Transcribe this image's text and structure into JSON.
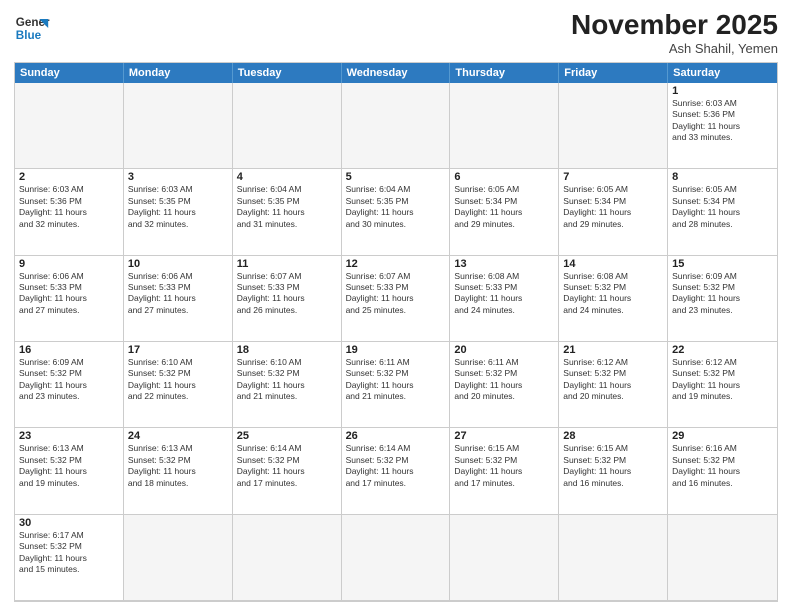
{
  "header": {
    "logo_general": "General",
    "logo_blue": "Blue",
    "month_year": "November 2025",
    "location": "Ash Shahil, Yemen"
  },
  "days_of_week": [
    "Sunday",
    "Monday",
    "Tuesday",
    "Wednesday",
    "Thursday",
    "Friday",
    "Saturday"
  ],
  "weeks": [
    [
      {
        "day": "",
        "info": ""
      },
      {
        "day": "",
        "info": ""
      },
      {
        "day": "",
        "info": ""
      },
      {
        "day": "",
        "info": ""
      },
      {
        "day": "",
        "info": ""
      },
      {
        "day": "",
        "info": ""
      },
      {
        "day": "1",
        "info": "Sunrise: 6:03 AM\nSunset: 5:36 PM\nDaylight: 11 hours\nand 33 minutes."
      }
    ],
    [
      {
        "day": "2",
        "info": "Sunrise: 6:03 AM\nSunset: 5:36 PM\nDaylight: 11 hours\nand 32 minutes."
      },
      {
        "day": "3",
        "info": "Sunrise: 6:03 AM\nSunset: 5:35 PM\nDaylight: 11 hours\nand 32 minutes."
      },
      {
        "day": "4",
        "info": "Sunrise: 6:04 AM\nSunset: 5:35 PM\nDaylight: 11 hours\nand 31 minutes."
      },
      {
        "day": "5",
        "info": "Sunrise: 6:04 AM\nSunset: 5:35 PM\nDaylight: 11 hours\nand 30 minutes."
      },
      {
        "day": "6",
        "info": "Sunrise: 6:05 AM\nSunset: 5:34 PM\nDaylight: 11 hours\nand 29 minutes."
      },
      {
        "day": "7",
        "info": "Sunrise: 6:05 AM\nSunset: 5:34 PM\nDaylight: 11 hours\nand 29 minutes."
      },
      {
        "day": "8",
        "info": "Sunrise: 6:05 AM\nSunset: 5:34 PM\nDaylight: 11 hours\nand 28 minutes."
      }
    ],
    [
      {
        "day": "9",
        "info": "Sunrise: 6:06 AM\nSunset: 5:33 PM\nDaylight: 11 hours\nand 27 minutes."
      },
      {
        "day": "10",
        "info": "Sunrise: 6:06 AM\nSunset: 5:33 PM\nDaylight: 11 hours\nand 27 minutes."
      },
      {
        "day": "11",
        "info": "Sunrise: 6:07 AM\nSunset: 5:33 PM\nDaylight: 11 hours\nand 26 minutes."
      },
      {
        "day": "12",
        "info": "Sunrise: 6:07 AM\nSunset: 5:33 PM\nDaylight: 11 hours\nand 25 minutes."
      },
      {
        "day": "13",
        "info": "Sunrise: 6:08 AM\nSunset: 5:33 PM\nDaylight: 11 hours\nand 24 minutes."
      },
      {
        "day": "14",
        "info": "Sunrise: 6:08 AM\nSunset: 5:32 PM\nDaylight: 11 hours\nand 24 minutes."
      },
      {
        "day": "15",
        "info": "Sunrise: 6:09 AM\nSunset: 5:32 PM\nDaylight: 11 hours\nand 23 minutes."
      }
    ],
    [
      {
        "day": "16",
        "info": "Sunrise: 6:09 AM\nSunset: 5:32 PM\nDaylight: 11 hours\nand 23 minutes."
      },
      {
        "day": "17",
        "info": "Sunrise: 6:10 AM\nSunset: 5:32 PM\nDaylight: 11 hours\nand 22 minutes."
      },
      {
        "day": "18",
        "info": "Sunrise: 6:10 AM\nSunset: 5:32 PM\nDaylight: 11 hours\nand 21 minutes."
      },
      {
        "day": "19",
        "info": "Sunrise: 6:11 AM\nSunset: 5:32 PM\nDaylight: 11 hours\nand 21 minutes."
      },
      {
        "day": "20",
        "info": "Sunrise: 6:11 AM\nSunset: 5:32 PM\nDaylight: 11 hours\nand 20 minutes."
      },
      {
        "day": "21",
        "info": "Sunrise: 6:12 AM\nSunset: 5:32 PM\nDaylight: 11 hours\nand 20 minutes."
      },
      {
        "day": "22",
        "info": "Sunrise: 6:12 AM\nSunset: 5:32 PM\nDaylight: 11 hours\nand 19 minutes."
      }
    ],
    [
      {
        "day": "23",
        "info": "Sunrise: 6:13 AM\nSunset: 5:32 PM\nDaylight: 11 hours\nand 19 minutes."
      },
      {
        "day": "24",
        "info": "Sunrise: 6:13 AM\nSunset: 5:32 PM\nDaylight: 11 hours\nand 18 minutes."
      },
      {
        "day": "25",
        "info": "Sunrise: 6:14 AM\nSunset: 5:32 PM\nDaylight: 11 hours\nand 17 minutes."
      },
      {
        "day": "26",
        "info": "Sunrise: 6:14 AM\nSunset: 5:32 PM\nDaylight: 11 hours\nand 17 minutes."
      },
      {
        "day": "27",
        "info": "Sunrise: 6:15 AM\nSunset: 5:32 PM\nDaylight: 11 hours\nand 17 minutes."
      },
      {
        "day": "28",
        "info": "Sunrise: 6:15 AM\nSunset: 5:32 PM\nDaylight: 11 hours\nand 16 minutes."
      },
      {
        "day": "29",
        "info": "Sunrise: 6:16 AM\nSunset: 5:32 PM\nDaylight: 11 hours\nand 16 minutes."
      }
    ],
    [
      {
        "day": "30",
        "info": "Sunrise: 6:17 AM\nSunset: 5:32 PM\nDaylight: 11 hours\nand 15 minutes."
      },
      {
        "day": "",
        "info": ""
      },
      {
        "day": "",
        "info": ""
      },
      {
        "day": "",
        "info": ""
      },
      {
        "day": "",
        "info": ""
      },
      {
        "day": "",
        "info": ""
      },
      {
        "day": "",
        "info": ""
      }
    ]
  ]
}
